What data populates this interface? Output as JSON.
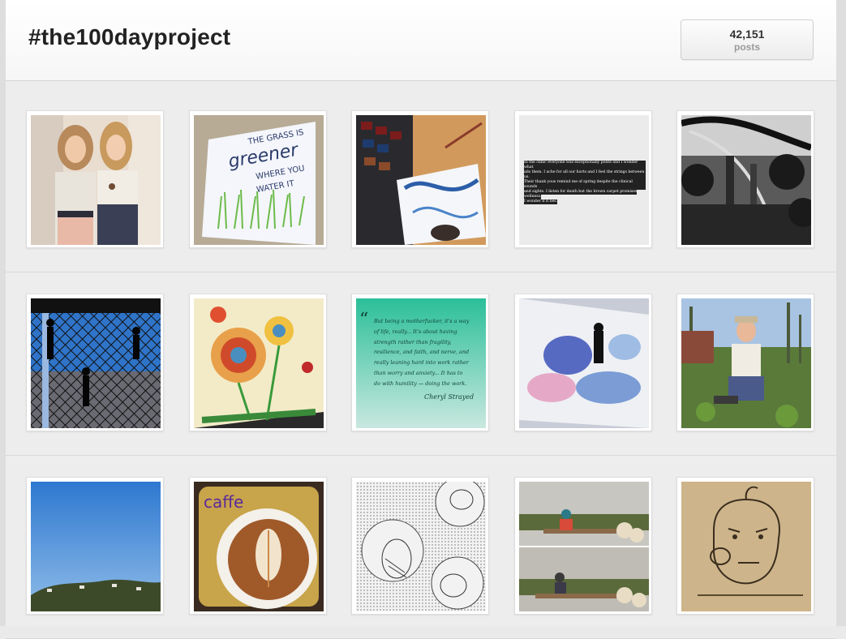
{
  "header": {
    "hashtag": "#the100dayproject",
    "post_count": "42,151",
    "post_count_label": "posts"
  },
  "posts": [
    {
      "index": 1,
      "subject": "two girls posing"
    },
    {
      "index": 2,
      "subject": "hand lettering",
      "text_lines": [
        "THE GRASS IS",
        "greener",
        "WHERE YOU",
        "WATER IT"
      ]
    },
    {
      "index": 3,
      "subject": "watercolor palette and painting"
    },
    {
      "index": 4,
      "subject": "text poem",
      "text_lines": [
        "In the clinic everyone was exceptionally polite and I wonder what",
        "ails them. I ache for all our hurts and I feel the strings between us.",
        "Their thank yous remind me of spring despite the clinical sounds",
        "and sights. I listen for death but the brown carpet promises",
        "wellness.",
        "I wonder if it lies."
      ]
    },
    {
      "index": 5,
      "subject": "black and white bridge"
    },
    {
      "index": 6,
      "subject": "silhouettes on fence"
    },
    {
      "index": 7,
      "subject": "flower drawing"
    },
    {
      "index": 8,
      "subject": "quote card",
      "text_lines": [
        "But being a motherfucker, it's a way",
        "of life, really... It's about having",
        "strength rather than fragility,",
        "resilience, and faith, and nerve, and",
        "really leaning hard into work rather",
        "than worry and anxiety... It has to",
        "do with humility — doing the work."
      ],
      "signature": "Cheryl Strayed"
    },
    {
      "index": 9,
      "subject": "blue and pink watercolor"
    },
    {
      "index": 10,
      "subject": "man kneeling in field"
    },
    {
      "index": 11,
      "subject": "blue sky over hills"
    },
    {
      "index": 12,
      "subject": "latte art",
      "text_lines": [
        "caffe"
      ]
    },
    {
      "index": 13,
      "subject": "dotted bird drawings"
    },
    {
      "index": 14,
      "subject": "child on swing collage"
    },
    {
      "index": 15,
      "subject": "sepia face sketch"
    }
  ]
}
